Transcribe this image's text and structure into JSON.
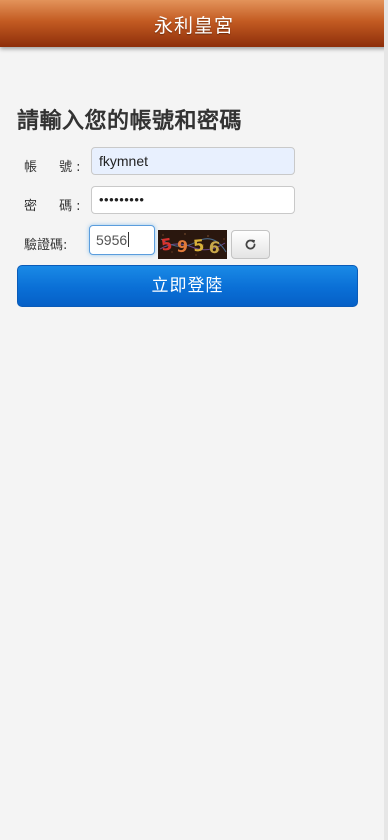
{
  "header": {
    "title": "永利皇宮"
  },
  "login_form": {
    "heading": "請輸入您的帳號和密碼",
    "account_label": "帳 號:",
    "account_value": "fkymnet",
    "password_label": "密 碼:",
    "password_value": "•••••••••",
    "captcha_label": "驗證碼:",
    "captcha_value": "5956",
    "captcha_image_text": "5956",
    "refresh_icon": "refresh-icon",
    "submit_label": "立即登陸"
  },
  "colors": {
    "header_top": "#e3935a",
    "header_bottom": "#8d2e0a",
    "button_blue": "#0a6fd6",
    "background": "#f4f4f4"
  }
}
